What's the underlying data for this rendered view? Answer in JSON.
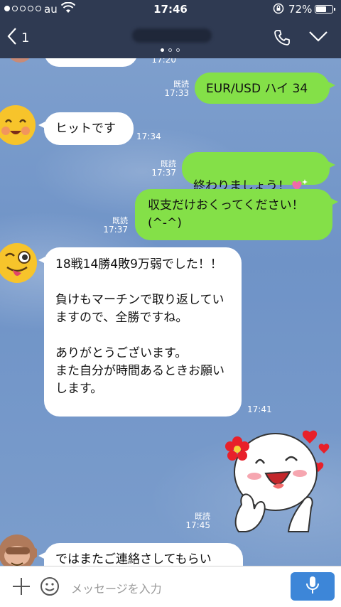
{
  "status_bar": {
    "signal_dots": [
      true,
      false,
      false,
      false,
      false
    ],
    "carrier": "au",
    "time": "17:46",
    "battery_percent": "72%",
    "battery_level": 0.72
  },
  "nav": {
    "back_count": "1",
    "page_indicator_count": 3,
    "page_indicator_active": 1
  },
  "messages": [
    {
      "id": "m0",
      "side": "in",
      "text": "",
      "time": "17:20",
      "partial": true
    },
    {
      "id": "m1",
      "side": "out",
      "read": "既読",
      "time": "17:33",
      "text": "EUR/USD ハイ 34"
    },
    {
      "id": "m2",
      "side": "in",
      "time": "17:34",
      "text": "ヒットです",
      "avatar": "grinning-face-icon"
    },
    {
      "id": "m3",
      "side": "out",
      "read": "既読",
      "time": "17:37",
      "text": "終わりましょう！",
      "emoji": "sparkling-heart-icon"
    },
    {
      "id": "m4",
      "side": "out",
      "read": "既読",
      "time": "17:37",
      "text": "収支だけおくってください！\n(^-^)"
    },
    {
      "id": "m5",
      "side": "in",
      "time": "17:41",
      "avatar": "winking-tongue-face-icon",
      "text": "18戦14勝4敗9万弱でした！！\n\n負けもマーチンで取り返していますので、全勝ですね。\n\nありがとうございます。\nまた自分が時間あるときお願いします。"
    },
    {
      "id": "m6",
      "side": "out",
      "read": "既読",
      "time": "17:45",
      "sticker": "happy-face-sticker-with-hearts"
    },
    {
      "id": "m7",
      "side": "in",
      "avatar": "monkey-avatar-icon",
      "text": "ではまたご連絡さしてもらい"
    }
  ],
  "input": {
    "placeholder": "メッセージを入力"
  },
  "colors": {
    "header": "#2f3a52",
    "outgoing_bubble": "#84e048",
    "incoming_bubble": "#ffffff",
    "mic_button": "#3d86d8"
  }
}
